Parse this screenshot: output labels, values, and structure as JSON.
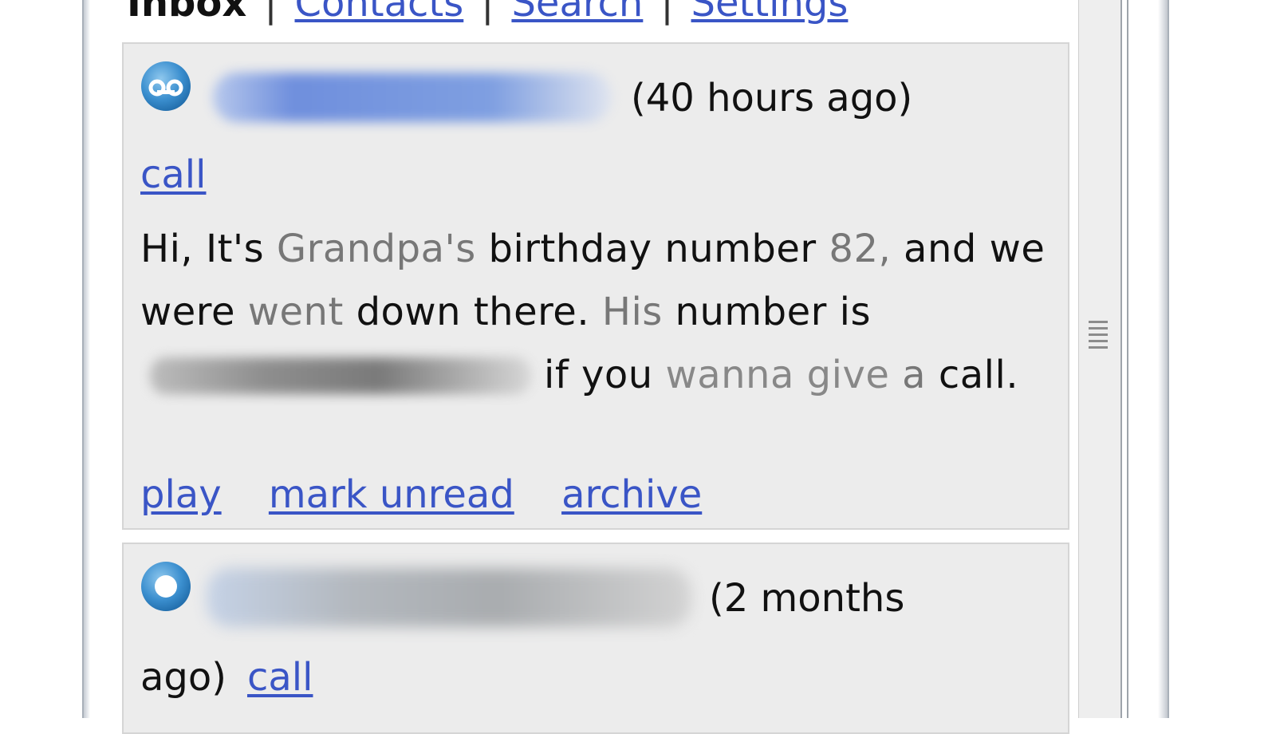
{
  "nav": {
    "current": "Inbox",
    "separator": "|",
    "links": [
      "Contacts",
      "Search",
      "Settings"
    ]
  },
  "messages": [
    {
      "status_icon": "voicemail-icon",
      "time": "(40 hours ago)",
      "call_label": "call",
      "transcript": {
        "w1": "Hi, It's",
        "w2": "Grandpa's",
        "w3": "birthday number",
        "w4": "82,",
        "w5": "and we were",
        "w6": "went",
        "w7": "down there.",
        "w8": "His",
        "w9": "number is",
        "w10": "if you",
        "w11": "wanna give",
        "w12": "a",
        "w13": "call."
      },
      "actions": {
        "play": "play",
        "mark_unread": "mark unread",
        "archive": "archive"
      }
    },
    {
      "status_icon": "unread-dot-icon",
      "time": "(2 months",
      "time_cont": "ago)",
      "call_label": "call"
    }
  ],
  "colors": {
    "link": "#3a55c6",
    "message_bg": "#ececec",
    "text": "#111111",
    "low_confidence": "#777777"
  }
}
